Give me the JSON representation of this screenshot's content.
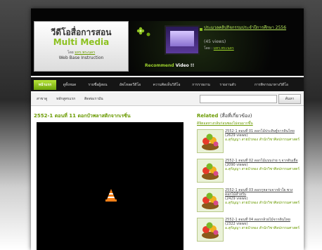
{
  "logo": {
    "title": "วีดีโอสื่อการสอน",
    "subtitle": "Multi Media",
    "by_prefix": "โดย",
    "by_name": "มทร.พระนคร",
    "tagline": "Web Base Instruction"
  },
  "recommend": {
    "label": "Recommend",
    "label_suffix": "Video !!",
    "title": "ประมวลคลิปกิจกรรมประจำปีการศึกษา 2556",
    "views": "(45 views)",
    "by_prefix": "โดย :",
    "by_name": "มทร.พระนคร"
  },
  "nav": {
    "items": [
      "หน้าแรก",
      "ดูทั้งหมด",
      "รายชื่อผู้สอน",
      "อัพโหลดวีดีโอ",
      "ความคิดเห็นวิดีโอ",
      "การรายงาน",
      "รายงานตัว",
      "การพิจารณาทางวิดีโอ"
    ],
    "active_index": 0
  },
  "subnav": {
    "items": [
      "สาขาดู",
      "หลักสูตรแรก",
      "ติดต่อเรามัน"
    ],
    "search_placeholder": "",
    "search_button": "ค้นหา"
  },
  "video": {
    "title": "2552-1 ตอนที่ 11 ดอกบัวพลาสติกจากเรซิ่น"
  },
  "related": {
    "title": "Related",
    "title_suffix": "(สื่อที่เกี่ยวข้อง)",
    "subtitle": "ดิจิตอลทางกลับก่อนซองไม่จนมากขึ้น",
    "items": [
      {
        "title": "2552-1 ตอนที่ 01 ดอกไม้ประดิษฐ์จากดินไทย",
        "views": "(2629 views)",
        "by": "อ.สุกัญญา สายบัวทอง สำนักวิชาศิลปกรรมศาสตร์"
      },
      {
        "title": "2552-1 ตอนที่ 02 ดอกไม้แบบง่าย ๆ จากดินเยื่อ",
        "views": "(2090 views)",
        "by": "อ.สุกัญญา สายบัวทอง สำนักวิชาศิลปกรรมศาสตร์"
      },
      {
        "title": "2552-1 ตอนที่ 03 ดอกกุหลาบจากผ้าใย พวงดอกไม้สำหรับ",
        "views": "(2429 views)",
        "by": "อ.สุกัญญา สายบัวทอง สำนักวิชาศิลปกรรมศาสตร์"
      },
      {
        "title": "2552-1 ตอนที่ 04 ดอกกล้วยไม้จากดินไทย",
        "views": "(2322 views)",
        "by": "อ.สุกัญญา สายบัวทอง สำนักวิชาศิลปกรรมศาสตร์"
      }
    ]
  },
  "colors": {
    "accent": "#8cc11f",
    "header_bg": "#050505",
    "link_green": "#6a9a00"
  }
}
